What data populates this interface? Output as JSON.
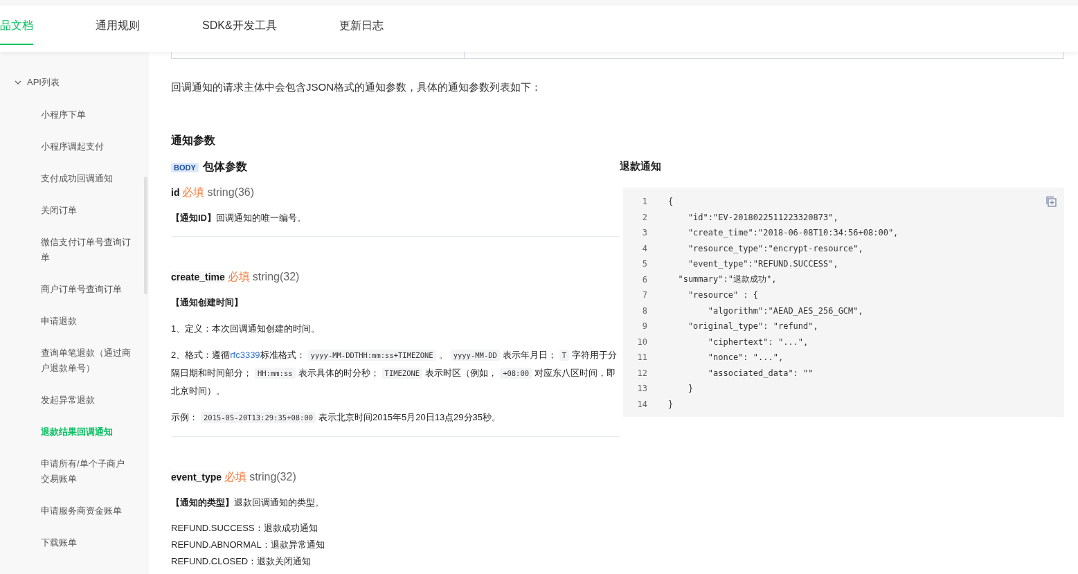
{
  "nav_tabs": [
    {
      "label": "品文档",
      "selected": true
    },
    {
      "label": "通用规则",
      "selected": false
    },
    {
      "label": "SDK&开发工具",
      "selected": false
    },
    {
      "label": "更新日志",
      "selected": false
    }
  ],
  "sidebar": {
    "group": {
      "label": "API列表",
      "expanded": true,
      "items": [
        {
          "label": "小程序下单",
          "selected": false
        },
        {
          "label": "小程序调起支付",
          "selected": false
        },
        {
          "label": "支付成功回调通知",
          "selected": false
        },
        {
          "label": "关闭订单",
          "selected": false
        },
        {
          "label": "微信支付订单号查询订单",
          "selected": false
        },
        {
          "label": "商户订单号查询订单",
          "selected": false
        },
        {
          "label": "申请退款",
          "selected": false
        },
        {
          "label": "查询单笔退款（通过商户退款单号）",
          "selected": false
        },
        {
          "label": "发起异常退款",
          "selected": false
        },
        {
          "label": "退款结果回调通知",
          "selected": true
        },
        {
          "label": "申请所有/单个子商户交易账单",
          "selected": false
        },
        {
          "label": "申请服务商资金账单",
          "selected": false
        },
        {
          "label": "下载账单",
          "selected": false
        }
      ]
    }
  },
  "intro": "回调通知的请求主体中会包含JSON格式的通知参数，具体的通知参数列表如下：",
  "section_title": "通知参数",
  "body_header": {
    "badge": "BODY",
    "title": "包体参数"
  },
  "params": [
    {
      "name": "id",
      "required": "必填",
      "type": "string(36)",
      "blocks": [
        {
          "kind": "paragraph",
          "segments": [
            {
              "kind": "text",
              "text": "**【通知ID】**回调通知的唯一编号。"
            }
          ]
        }
      ]
    },
    {
      "name": "create_time",
      "required": "必填",
      "type": "string(32)",
      "blocks": [
        {
          "kind": "paragraph",
          "segments": [
            {
              "kind": "text",
              "text": "**【通知创建时间】**"
            }
          ]
        },
        {
          "kind": "paragraph",
          "segments": [
            {
              "kind": "text",
              "text": "1、定义：本次回调通知创建的时间。"
            }
          ]
        },
        {
          "kind": "paragraph",
          "segments": [
            {
              "kind": "text",
              "text": "2、格式：遵循"
            },
            {
              "kind": "link",
              "text": "rfc3339"
            },
            {
              "kind": "text",
              "text": "标准格式："
            },
            {
              "kind": "code",
              "text": "yyyy-MM-DDTHH:mm:ss+TIMEZONE"
            },
            {
              "kind": "text",
              "text": "。"
            },
            {
              "kind": "code",
              "text": "yyyy-MM-DD"
            },
            {
              "kind": "text",
              "text": "表示年月日；"
            },
            {
              "kind": "code",
              "text": "T"
            },
            {
              "kind": "text",
              "text": "字符用于分隔日期和时间部分；"
            },
            {
              "kind": "code",
              "text": "HH:mm:ss"
            },
            {
              "kind": "text",
              "text": "表示具体的时分秒；"
            },
            {
              "kind": "code",
              "text": "TIMEZONE"
            },
            {
              "kind": "text",
              "text": "表示时区（例如，"
            },
            {
              "kind": "code",
              "text": "+08:00"
            },
            {
              "kind": "text",
              "text": "对应东八区时间，即北京时间）。"
            }
          ]
        },
        {
          "kind": "paragraph",
          "segments": [
            {
              "kind": "text",
              "text": "示例："
            },
            {
              "kind": "code",
              "text": "2015-05-20T13:29:35+08:00"
            },
            {
              "kind": "text",
              "text": "表示北京时间2015年5月20日13点29分35秒。"
            }
          ]
        }
      ]
    },
    {
      "name": "event_type",
      "required": "必填",
      "type": "string(32)",
      "blocks": [
        {
          "kind": "paragraph",
          "segments": [
            {
              "kind": "text",
              "text": "**【通知的类型】**退款回调通知的类型。"
            }
          ]
        },
        {
          "kind": "list",
          "items": [
            "REFUND.SUCCESS：退款成功通知",
            "REFUND.ABNORMAL：退款异常通知",
            "REFUND.CLOSED：退款关闭通知"
          ]
        }
      ]
    }
  ],
  "example": {
    "title": "退款通知",
    "lines": [
      {
        "number": "1",
        "code": "{"
      },
      {
        "number": "2",
        "code": "    \"id\":\"EV-2018022511223320873\","
      },
      {
        "number": "3",
        "code": "    \"create_time\":\"2018-06-08T10:34:56+08:00\","
      },
      {
        "number": "4",
        "code": "    \"resource_type\":\"encrypt-resource\","
      },
      {
        "number": "5",
        "code": "    \"event_type\":\"REFUND.SUCCESS\","
      },
      {
        "number": "6",
        "code": "  \"summary\":\"退款成功\","
      },
      {
        "number": "7",
        "code": "    \"resource\" : {"
      },
      {
        "number": "8",
        "code": "        \"algorithm\":\"AEAD_AES_256_GCM\","
      },
      {
        "number": "9",
        "code": "    \"original_type\": \"refund\","
      },
      {
        "number": "10",
        "code": "        \"ciphertext\": \"...\","
      },
      {
        "number": "11",
        "code": "        \"nonce\": \"...\","
      },
      {
        "number": "12",
        "code": "        \"associated_data\": \"\""
      },
      {
        "number": "13",
        "code": "    }"
      },
      {
        "number": "14",
        "code": "}"
      }
    ]
  }
}
